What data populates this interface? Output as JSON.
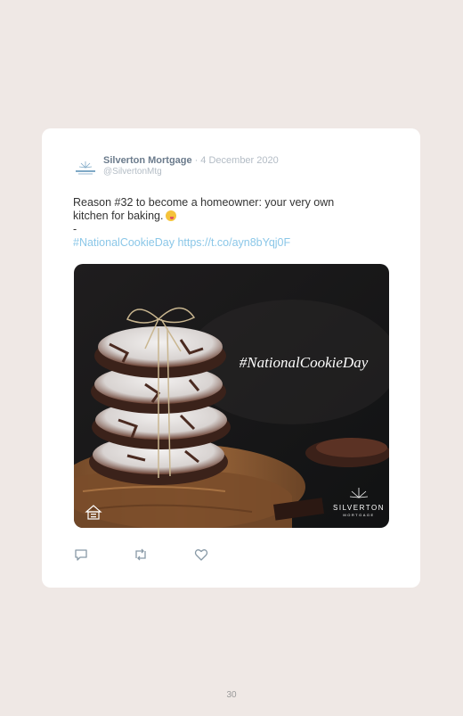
{
  "tweet": {
    "author": "Silverton Mortgage",
    "separator": "·",
    "date": "4 December 2020",
    "handle": "@SilvertonMtg",
    "text_line1": "Reason #32 to become a homeowner: your very own",
    "text_line2": "kitchen for baking.",
    "dash": "-",
    "hashtag": "#NationalCookieDay",
    "url": "https://t.co/ayn8bYqj0F",
    "emoji": "face-savoring-food-emoji"
  },
  "image": {
    "overlay_text": "#NationalCookieDay",
    "logo_text": "SILVERTON",
    "logo_subtext": "MORTGAGE"
  },
  "actions": {
    "reply_icon": "reply-icon",
    "retweet_icon": "retweet-icon",
    "like_icon": "like-icon"
  },
  "page_number": "30",
  "colors": {
    "page_bg": "#efe8e5",
    "card_bg": "#ffffff",
    "author": "#6b7b8c",
    "muted": "#b3bcc5",
    "link": "#8bc7e8",
    "text": "#333333"
  }
}
